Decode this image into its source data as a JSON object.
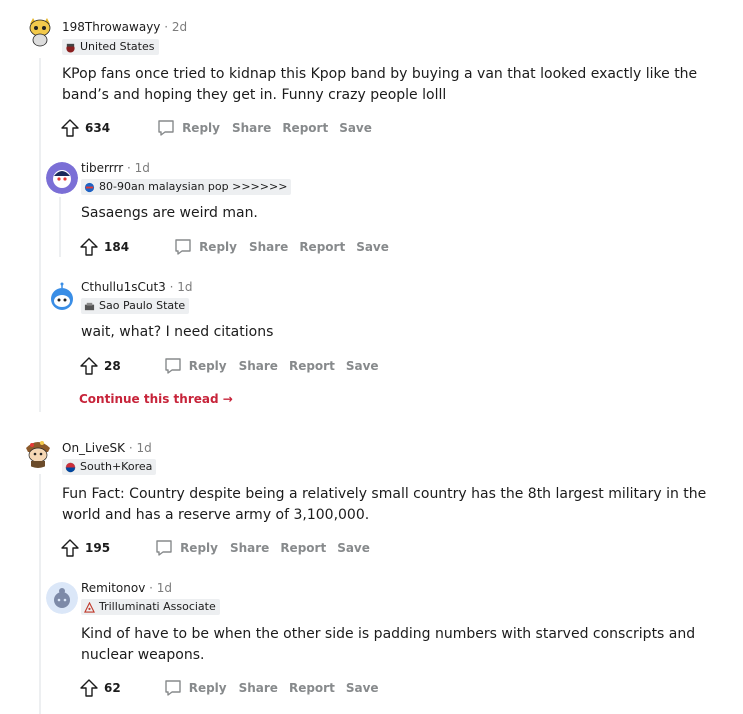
{
  "comments": [
    {
      "author": "198Throwawayy",
      "time": "2d",
      "flair": "United States",
      "text": "KPop fans once tried to kidnap this Kpop band by buying a van that looked exactly like the band’s and hoping they get in. Funny crazy people lolll",
      "score": "634"
    },
    {
      "author": "tiberrrr",
      "time": "1d",
      "flair": "80-90an malaysian pop >>>>>>",
      "text": "Sasaengs are weird man.",
      "score": "184"
    },
    {
      "author": "Cthullu1sCut3",
      "time": "1d",
      "flair": "Sao Paulo State",
      "text": "wait, what? I need citations",
      "score": "28"
    },
    {
      "author": "On_LiveSK",
      "time": "1d",
      "flair": "South+Korea",
      "text": "Fun Fact: Country despite being a relatively small country has the 8th largest military in the world and has a reserve army of 3,100,000.",
      "score": "195"
    },
    {
      "author": "Remitonov",
      "time": "1d",
      "flair": "Trilluminati Associate",
      "text": "Kind of have to be when the other side is padding numbers with starved conscripts and nuclear weapons.",
      "score": "62"
    }
  ],
  "actions": {
    "reply": "Reply",
    "share": "Share",
    "report": "Report",
    "save": "Save"
  },
  "separator": "·",
  "continue_thread": "Continue this thread",
  "continue_arrow": "→",
  "colors": {
    "accent": "#c7243a",
    "meta_gray": "#7c7c7c",
    "action_gray": "#878a8c",
    "flair_bg": "#edeff1"
  }
}
